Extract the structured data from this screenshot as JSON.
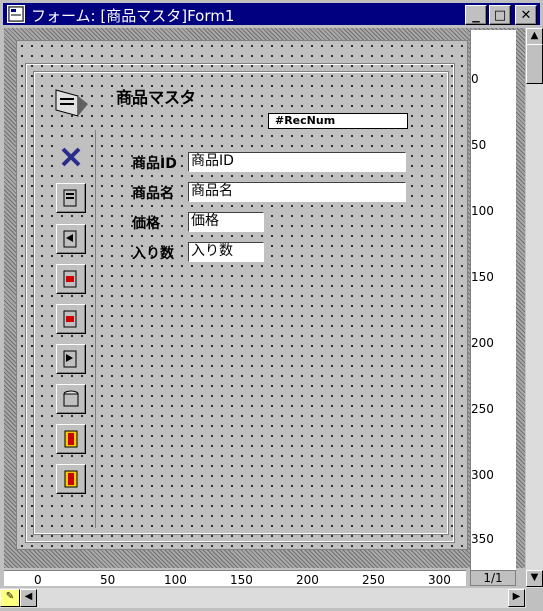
{
  "window": {
    "title": "フォーム: [商品マスタ]Form1",
    "min": "_",
    "max": "□",
    "close": "✕"
  },
  "form": {
    "title": "商品マスタ",
    "recnum": "#RecNum",
    "fields": [
      {
        "label": "商品ID",
        "value": "商品ID"
      },
      {
        "label": "商品名",
        "value": "商品名"
      },
      {
        "label": "価格",
        "value": "価格"
      },
      {
        "label": "入り数",
        "value": "入り数"
      }
    ],
    "nav_buttons": [
      "delete-icon",
      "first-record-icon",
      "prev-record-icon",
      "next-record-icon",
      "last-record-icon",
      "save-record-icon",
      "print-icon",
      "exit-icon",
      "close-form-icon"
    ]
  },
  "ruler_v": [
    "0",
    "50",
    "100",
    "150",
    "200",
    "250",
    "300",
    "350"
  ],
  "ruler_h": [
    "0",
    "50",
    "100",
    "150",
    "200",
    "250",
    "300"
  ],
  "page_indicator": "1/1",
  "colors": {
    "titlebar": "#000080",
    "background": "#c0c0c0"
  }
}
